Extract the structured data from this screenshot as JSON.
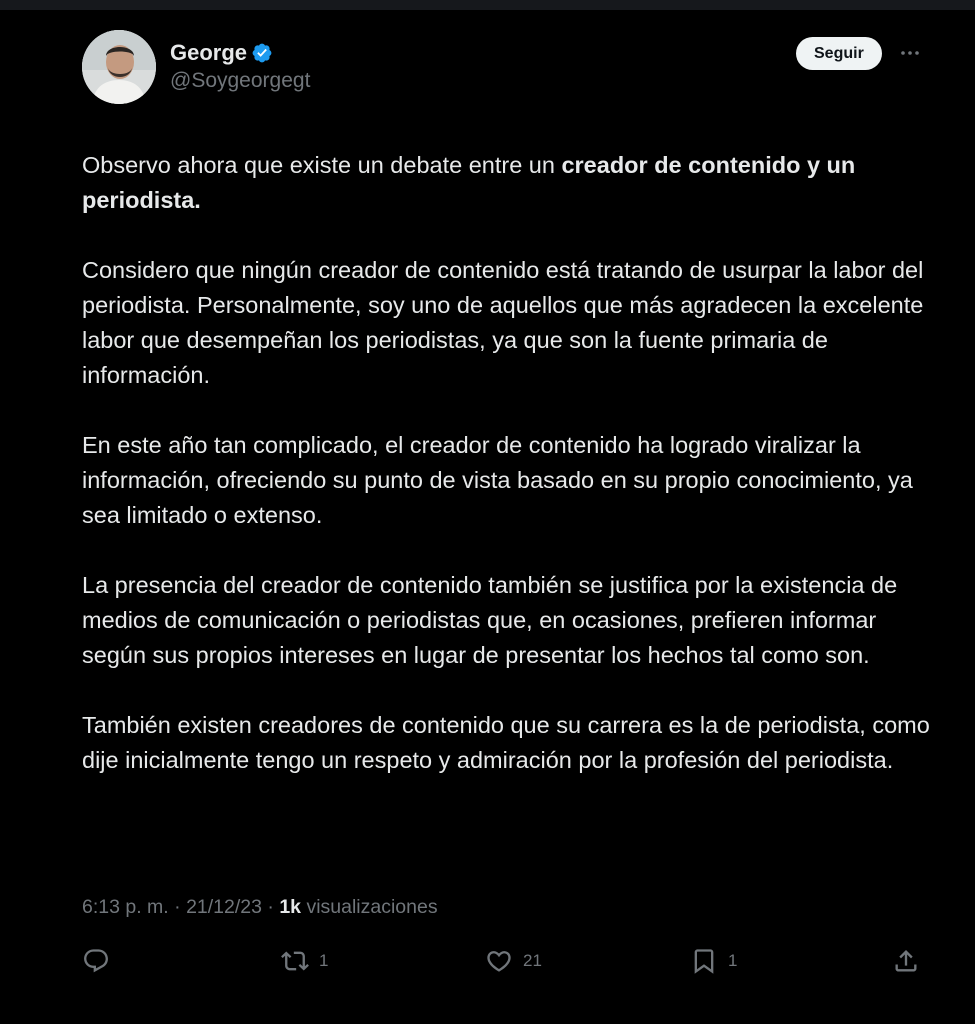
{
  "tweet": {
    "author_name": "George",
    "author_handle": "@Soygeorgegt",
    "follow_label": "Seguir",
    "paragraphs": [
      {
        "text_before": "Observo ahora que existe un debate entre un ",
        "bold": "creador de contenido y un periodista."
      },
      {
        "text": "Considero que ningún creador de contenido está tratando de usurpar la labor del periodista. Personalmente, soy uno de aquellos que más agradecen la excelente labor que desempeñan los periodistas, ya que son la fuente primaria de información."
      },
      {
        "text": "En este año tan complicado, el creador de contenido ha logrado viralizar la información, ofreciendo su punto de vista basado en su propio conocimiento, ya sea limitado o extenso."
      },
      {
        "text": "La presencia del creador de contenido también se justifica por la existencia de medios de comunicación o periodistas que, en ocasiones, prefieren informar según sus propios intereses en lugar de presentar los hechos tal como son."
      },
      {
        "text": "También existen creadores de contenido que su carrera es la de periodista, como dije inicialmente tengo un respeto y admiración por la profesión del periodista."
      }
    ],
    "time": "6:13 p. m.",
    "separator": "·",
    "date": "21/12/23",
    "views_count": "1k",
    "views_label": "visualizaciones",
    "actions": {
      "reply_icon": "reply-icon",
      "retweet_icon": "retweet-icon",
      "retweet_count": "1",
      "like_icon": "heart-icon",
      "like_count": "21",
      "bookmark_icon": "bookmark-icon",
      "bookmark_count": "1",
      "share_icon": "share-icon"
    },
    "colors": {
      "background": "#000000",
      "text": "#e7e9ea",
      "secondary": "#71767b",
      "verified": "#1d9bf0"
    }
  }
}
